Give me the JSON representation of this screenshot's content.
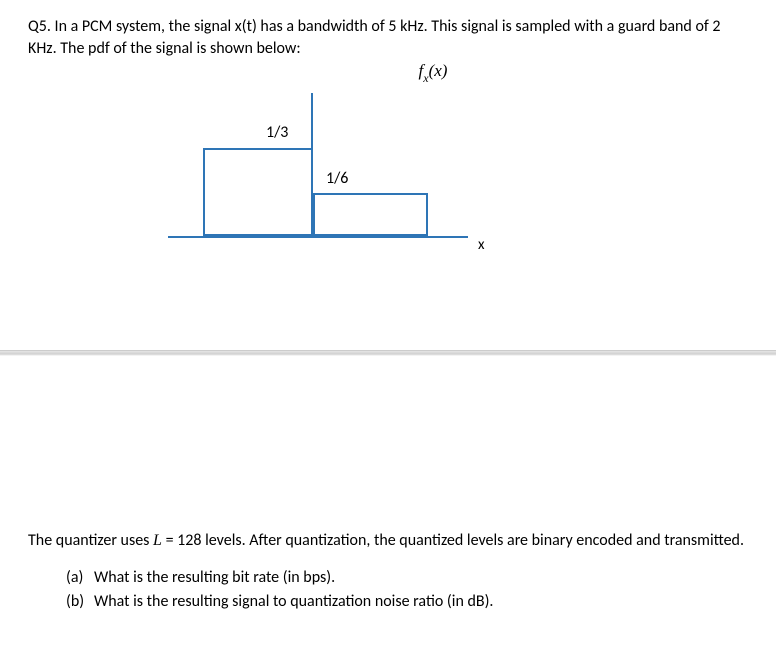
{
  "question": {
    "text": "Q5. In a PCM system, the signal x(t) has a bandwidth of 5 kHz. This signal is sampled with a guard band of 2 KHz. The pdf of the signal is shown below:",
    "pdf_label": "fₓ(x)"
  },
  "chart_data": {
    "type": "bar",
    "title": "fₓ(x)",
    "xlabel": "x",
    "ylabel": "",
    "description": "Piecewise-constant PDF (step histogram). Left block at height 1/3 spanning a negative-x interval, right block at height 1/6 spanning a positive-x interval (twice the width).",
    "series": [
      {
        "name": "left-block",
        "height_label": "1/3",
        "height": 0.3333
      },
      {
        "name": "right-block",
        "height_label": "1/6",
        "height": 0.1667
      }
    ],
    "labels": {
      "left_height": "1/3",
      "right_height": "1/6",
      "x_axis_var": "x"
    }
  },
  "quantizer_text_prefix": "The quantizer uses ",
  "quantizer_L_symbol": "L",
  "quantizer_text_eq": " = 128 levels. After quantization, the quantized levels are binary encoded and transmitted.",
  "parts": {
    "a_marker": "(a)",
    "a_text": "What is the resulting bit rate (in bps).",
    "b_marker": "(b)",
    "b_text": "What is the resulting signal to quantization noise ratio (in dB)."
  }
}
